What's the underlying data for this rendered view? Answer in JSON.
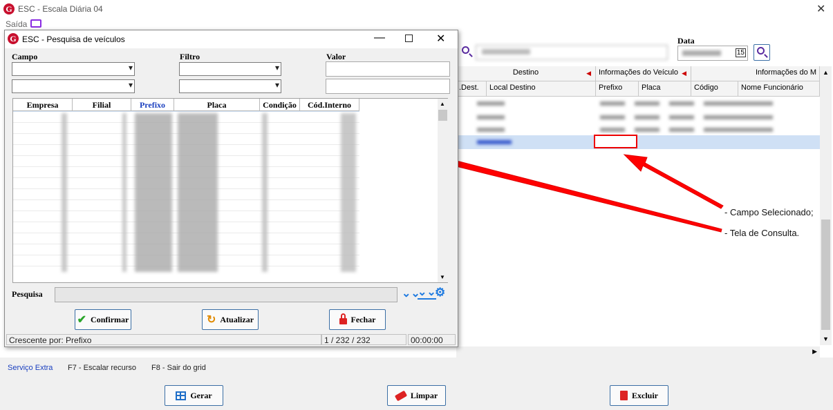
{
  "main_window": {
    "title": "ESC - Escala Diária 04",
    "menu_saida": "Saída",
    "data_label": "Data",
    "date_picker_icon": "15",
    "grid_headers_top": [
      "Destino",
      "Informações do Veículo",
      "Informações do M"
    ],
    "grid_headers_sub": [
      ".Dest.",
      "Local Destino",
      "Prefixo",
      "Placa",
      "Código",
      "Nome Funcionário"
    ],
    "shortcuts": [
      "Serviço Extra",
      "F7 - Escalar recurso",
      "F8 - Sair do grid"
    ],
    "buttons": {
      "gerar": "Gerar",
      "limpar": "Limpar",
      "excluir": "Excluir"
    }
  },
  "dialog": {
    "title": "ESC - Pesquisa de veículos",
    "labels": {
      "campo": "Campo",
      "filtro": "Filtro",
      "valor": "Valor",
      "pesquisa": "Pesquisa"
    },
    "columns": [
      "Empresa",
      "Filial",
      "Prefixo",
      "Placa",
      "Condição",
      "Cód.Interno"
    ],
    "buttons": {
      "confirmar": "Confirmar",
      "atualizar": "Atualizar",
      "fechar": "Fechar"
    },
    "status": {
      "sort": "Crescente por: Prefixo",
      "count": "1 / 232 / 232",
      "time": "00:00:00"
    }
  },
  "annotations": [
    "- Campo Selecionado;",
    "- Tela de Consulta."
  ],
  "colors": {
    "accent": "#1e7ae0",
    "arrow": "#ff0000",
    "selection": "#cfe0f5"
  }
}
